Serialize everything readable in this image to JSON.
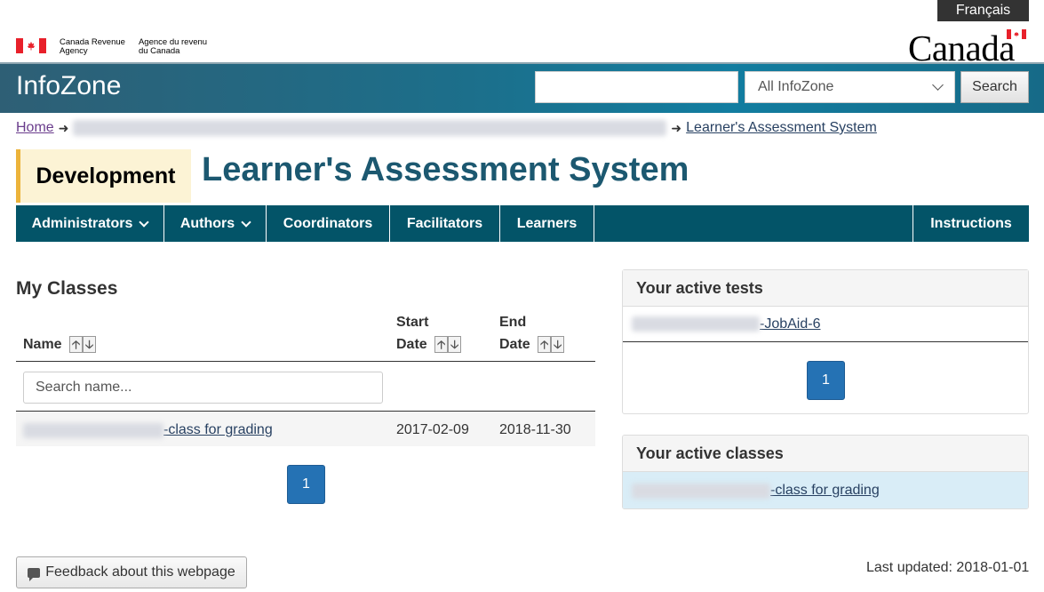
{
  "language_toggle": "Français",
  "signature": {
    "en_line1": "Canada Revenue",
    "en_line2": "Agency",
    "fr_line1": "Agence du revenu",
    "fr_line2": "du Canada"
  },
  "wordmark": "Canada",
  "header": {
    "site_title": "InfoZone",
    "search_placeholder": "",
    "scope_selected": "All InfoZone",
    "search_button": "Search"
  },
  "breadcrumb": {
    "home": "Home",
    "current": "Learner's Assessment System"
  },
  "environment_badge": "Development",
  "page_title": "Learner's Assessment System",
  "nav": {
    "items": [
      {
        "label": "Administrators",
        "dropdown": true
      },
      {
        "label": "Authors",
        "dropdown": true
      },
      {
        "label": "Coordinators"
      },
      {
        "label": "Facilitators"
      },
      {
        "label": "Learners"
      }
    ],
    "right_item": "Instructions"
  },
  "my_classes": {
    "title": "My Classes",
    "columns": {
      "name": "Name",
      "start_line1": "Start",
      "start_line2": "Date",
      "end_line1": "End",
      "end_line2": "Date"
    },
    "search_placeholder": "Search name...",
    "rows": [
      {
        "name_suffix": "-class for grading",
        "start": "2017-02-09",
        "end": "2018-11-30"
      }
    ],
    "page": "1"
  },
  "active_tests": {
    "title": "Your active tests",
    "item_suffix": "-JobAid-6",
    "page": "1"
  },
  "active_classes": {
    "title": "Your active classes",
    "item_suffix": "-class for grading"
  },
  "footer": {
    "feedback": "Feedback about this webpage",
    "last_updated": "Last updated: 2018-01-01"
  }
}
